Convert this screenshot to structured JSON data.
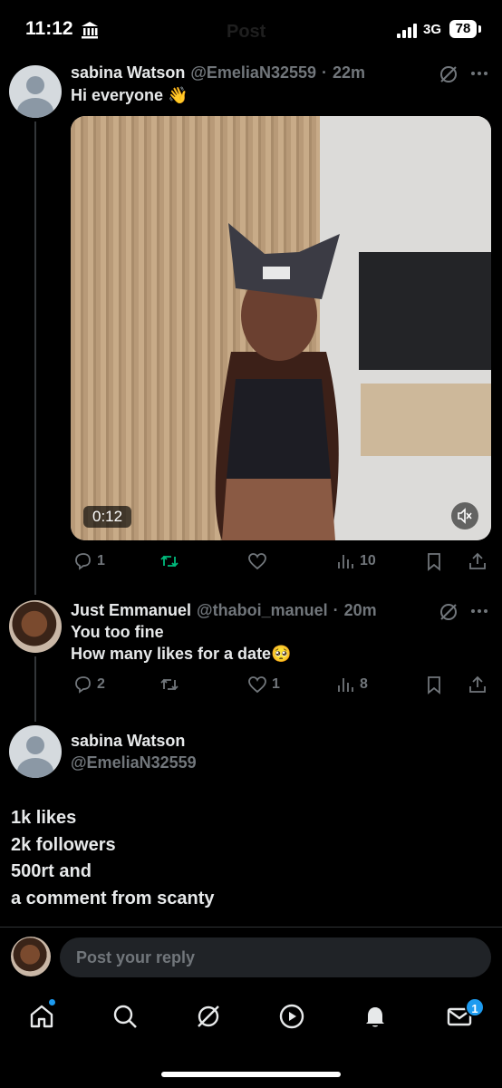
{
  "status": {
    "time": "11:12",
    "title_ghost": "Post",
    "network": "3G",
    "battery": "78"
  },
  "post": {
    "name": "sabina Watson",
    "handle": "@EmeliaN32559",
    "sep": "·",
    "time": "22m",
    "text": "Hi everyone 👋",
    "video_duration": "0:12",
    "actions": {
      "replies": "1",
      "reposts": "",
      "likes": "",
      "views": "10"
    }
  },
  "reply": {
    "name": "Just Emmanuel",
    "handle": "@thaboi_manuel",
    "sep": "·",
    "time": "20m",
    "line1": "You too fine",
    "line2": "How many likes for a date🥺",
    "actions": {
      "replies": "2",
      "reposts": "",
      "likes": "1",
      "views": "8"
    }
  },
  "main": {
    "name": "sabina Watson",
    "handle": "@EmeliaN32559",
    "lines": [
      "1k likes",
      "2k followers",
      "500rt and",
      "a comment from scanty"
    ]
  },
  "composer": {
    "placeholder": "Post your reply"
  },
  "nav": {
    "messages_badge": "1"
  },
  "colors": {
    "accent": "#1d9bf0",
    "repost_green": "#00ba7c",
    "muted": "#71767b",
    "background": "#000000"
  },
  "icons": {
    "status": [
      "bank-icon",
      "signal-icon"
    ],
    "tweet_actions": [
      "reply-icon",
      "repost-icon",
      "like-icon",
      "views-icon",
      "bookmark-icon",
      "share-icon"
    ],
    "nav": [
      "home-icon",
      "search-icon",
      "grok-icon",
      "video-icon",
      "notifications-icon",
      "messages-icon"
    ]
  }
}
